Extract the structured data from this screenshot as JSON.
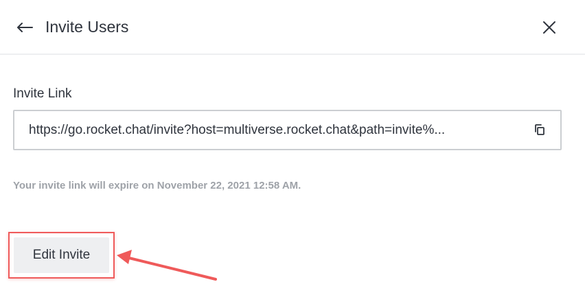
{
  "header": {
    "title": "Invite Users",
    "back_icon": "back-arrow-icon",
    "close_icon": "close-icon"
  },
  "invite": {
    "label": "Invite Link",
    "link_value": "https://go.rocket.chat/invite?host=multiverse.rocket.chat&path=invite%...",
    "copy_icon": "copy-icon",
    "expiry_text": "Your invite link will expire on November 22, 2021 12:58 AM."
  },
  "actions": {
    "edit_label": "Edit Invite"
  },
  "colors": {
    "text": "#2f343d",
    "muted": "#9ea2a8",
    "border": "#cbced1",
    "button_bg": "#eeeff1",
    "annotation": "#ef5a5a"
  }
}
